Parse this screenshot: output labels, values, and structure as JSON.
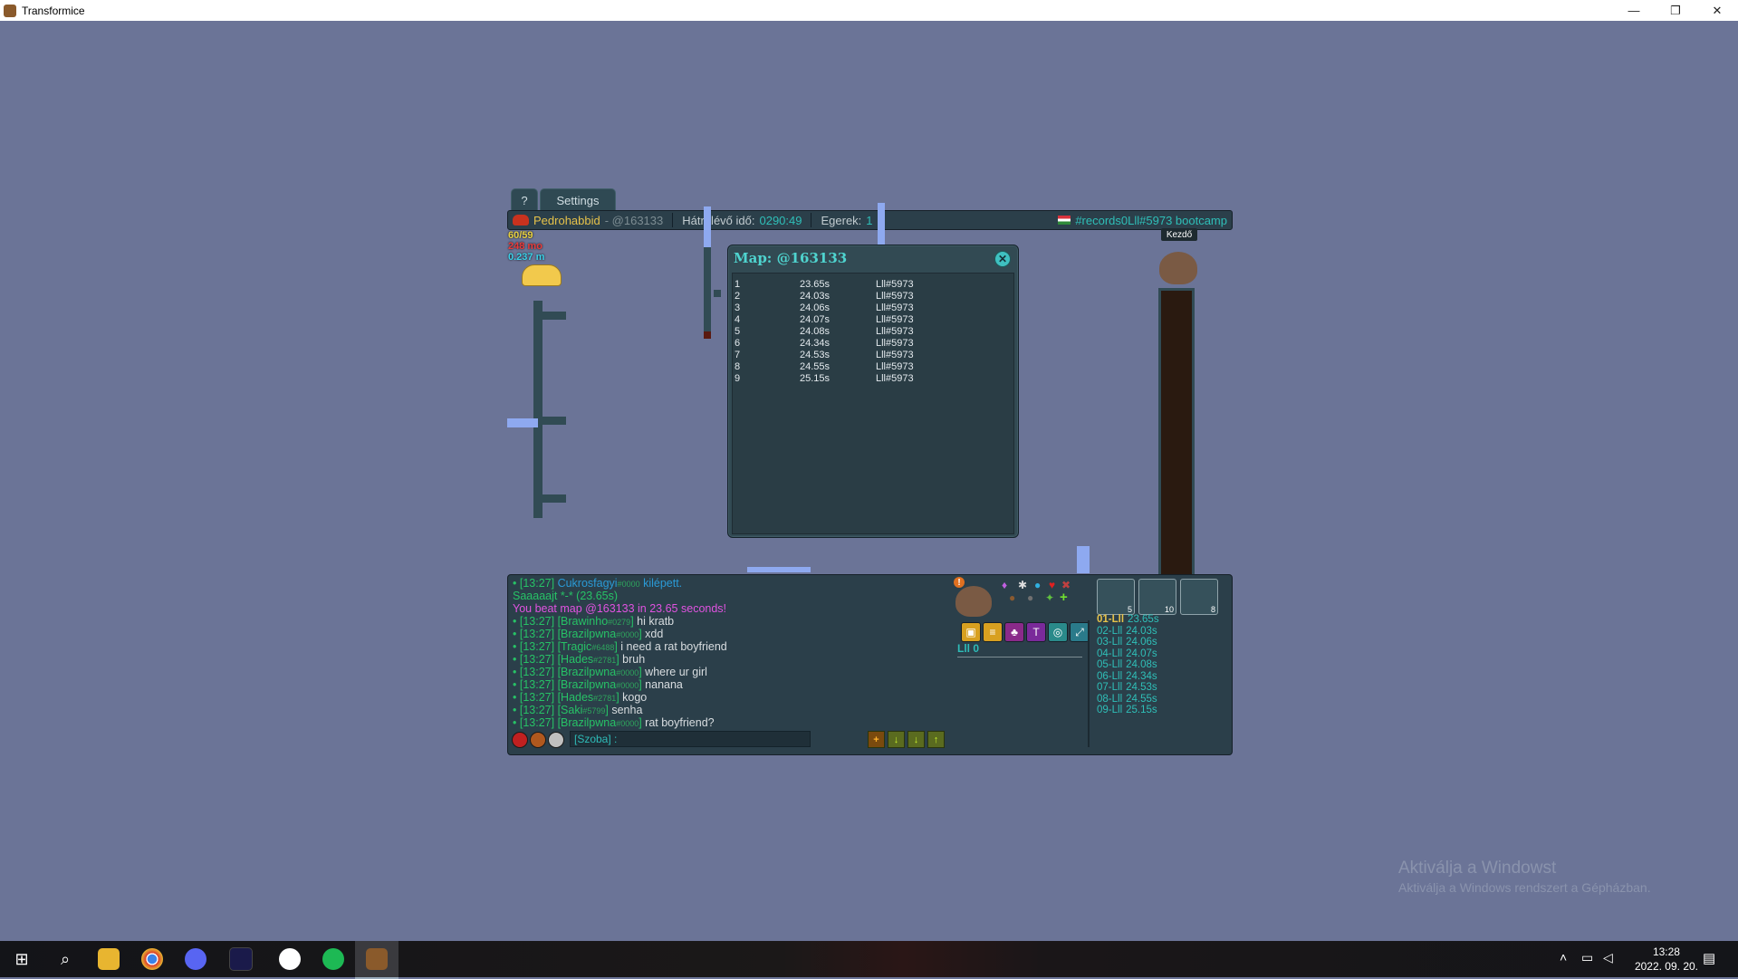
{
  "window": {
    "title": "Transformice",
    "minimize": "—",
    "maximize": "❐",
    "close": "✕"
  },
  "tabs": {
    "help": "?",
    "settings": "Settings"
  },
  "topbar": {
    "player": "Pedrohabbid",
    "map_code": "- @163133",
    "time_label": "Hátralévő idő:",
    "time_value": "0290:49",
    "mice_label": "Egerek:",
    "mice_value": "1",
    "room": "#records0Lll#5973 bootcamp"
  },
  "stats": {
    "line1": "60/59",
    "line2": "248 mo",
    "line3": "0.237 m"
  },
  "spawn_label": "Kezdő",
  "map_window": {
    "title": "Map: @163133",
    "close": "✕",
    "records": [
      {
        "rank": "1",
        "time": "23.65s",
        "player": "Lll#5973"
      },
      {
        "rank": "2",
        "time": "24.03s",
        "player": "Lll#5973"
      },
      {
        "rank": "3",
        "time": "24.06s",
        "player": "Lll#5973"
      },
      {
        "rank": "4",
        "time": "24.07s",
        "player": "Lll#5973"
      },
      {
        "rank": "5",
        "time": "24.08s",
        "player": "Lll#5973"
      },
      {
        "rank": "6",
        "time": "24.34s",
        "player": "Lll#5973"
      },
      {
        "rank": "7",
        "time": "24.53s",
        "player": "Lll#5973"
      },
      {
        "rank": "8",
        "time": "24.55s",
        "player": "Lll#5973"
      },
      {
        "rank": "9",
        "time": "25.15s",
        "player": "Lll#5973"
      }
    ]
  },
  "chat": {
    "lines": [
      {
        "prefix": "• [13:27] ",
        "name": "Cukrosfagyi",
        "hash": "#0000",
        "text": " kilépett.",
        "style": "leave"
      },
      {
        "prefix": "",
        "name": "",
        "hash": "",
        "text": "Saaaaajt *-* (23.65s)",
        "style": "cheese"
      },
      {
        "prefix": "",
        "name": "",
        "hash": "",
        "text": "You beat map @163133 in 23.65 seconds!",
        "style": "beat"
      },
      {
        "prefix": "• [13:27] ",
        "name": "[Brawinho",
        "hash": "#0279",
        "text": "hi kratb",
        "style": "msg"
      },
      {
        "prefix": "• [13:27] ",
        "name": "[Brazilpwna",
        "hash": "#0000",
        "text": "xdd",
        "style": "msg"
      },
      {
        "prefix": "• [13:27] ",
        "name": "[Tragic",
        "hash": "#6488",
        "text": "i need a rat boyfriend",
        "style": "msg"
      },
      {
        "prefix": "• [13:27] ",
        "name": "[Hades",
        "hash": "#2781",
        "text": "bruh",
        "style": "msg"
      },
      {
        "prefix": "• [13:27] ",
        "name": "[Brazilpwna",
        "hash": "#0000",
        "text": "where ur girl",
        "style": "msg"
      },
      {
        "prefix": "• [13:27] ",
        "name": "[Brazilpwna",
        "hash": "#0000",
        "text": "nanana",
        "style": "msg"
      },
      {
        "prefix": "• [13:27] ",
        "name": "[Hades",
        "hash": "#2781",
        "text": "kogo",
        "style": "msg"
      },
      {
        "prefix": "• [13:27] ",
        "name": "[Saki",
        "hash": "#5799",
        "text": "senha",
        "style": "msg"
      },
      {
        "prefix": "• [13:27] ",
        "name": "[Brazilpwna",
        "hash": "#0000",
        "text": "rat boyfriend?",
        "style": "msg"
      }
    ],
    "input_value": "[Szoba] :"
  },
  "player_panel": {
    "name": "Lll 0",
    "alert": "!"
  },
  "skills": [
    "5",
    "10",
    "8"
  ],
  "leaderboard": [
    {
      "rank": "01-Lll",
      "time": "23.65s",
      "first": true
    },
    {
      "rank": "02-Lll",
      "time": "24.03s"
    },
    {
      "rank": "03-Lll",
      "time": "24.06s"
    },
    {
      "rank": "04-Lll",
      "time": "24.07s"
    },
    {
      "rank": "05-Lll",
      "time": "24.08s"
    },
    {
      "rank": "06-Lll",
      "time": "24.34s"
    },
    {
      "rank": "07-Lll",
      "time": "24.53s"
    },
    {
      "rank": "08-Lll",
      "time": "24.55s"
    },
    {
      "rank": "09-Lll",
      "time": "25.15s"
    }
  ],
  "watermark": {
    "line1": "Aktiválja a Windowst",
    "line2": "Aktiválja a Windows rendszert a Gépházban."
  },
  "clock": {
    "time": "13:28",
    "date": "2022. 09. 20."
  },
  "colors": {
    "background": "#6b7497",
    "panel": "#2b3f4a",
    "accent": "#2fbfb8",
    "chat_green": "#27c266",
    "beat_pink": "#e153e1"
  }
}
